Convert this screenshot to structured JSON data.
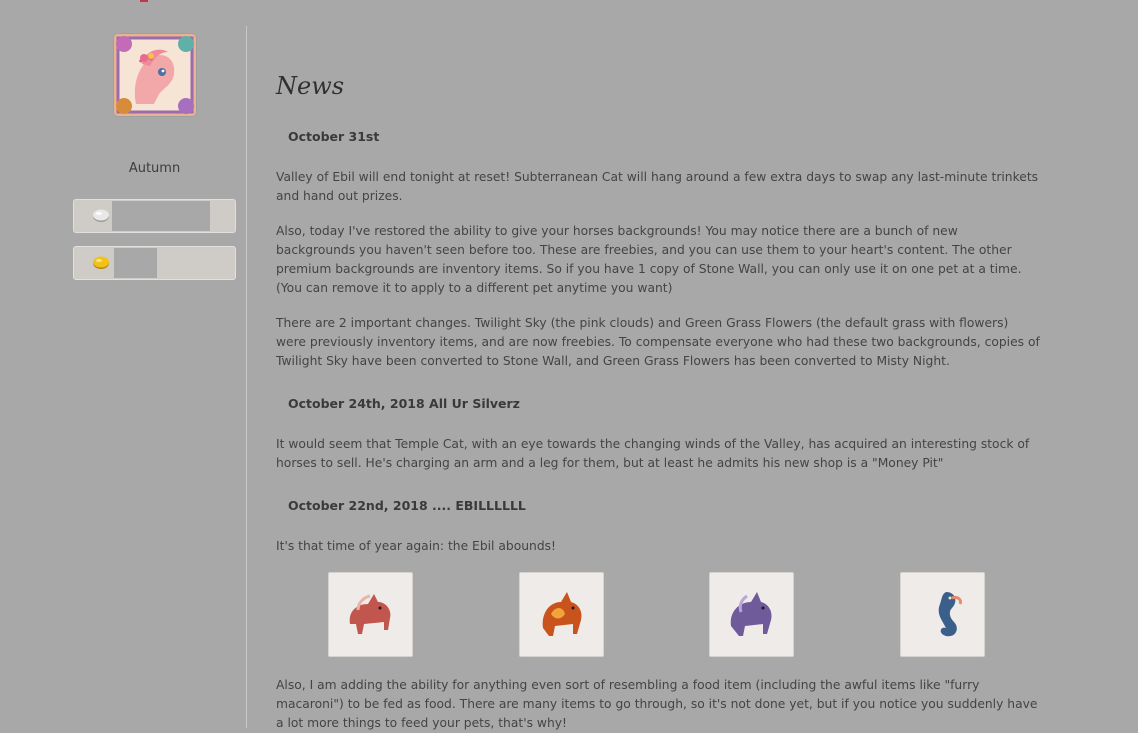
{
  "sidebar": {
    "username": "Autumn",
    "currencies": [
      {
        "name": "silver",
        "level": 0.61
      },
      {
        "name": "gold",
        "level": 0.27
      }
    ]
  },
  "news": {
    "title": "News",
    "sections": [
      {
        "heading": "October 31st",
        "paragraphs": [
          "Valley of Ebil will end tonight at reset! Subterranean Cat will hang around a few extra days to swap any last-minute trinkets and hand out prizes.",
          "Also, today I've restored the ability to give your horses backgrounds! You may notice there are a bunch of new backgrounds you haven't seen before too. These are freebies, and you can use them to your heart's content. The other premium backgrounds are inventory items. So if you have 1 copy of Stone Wall, you can only use it on one pet at a time. (You can remove it to apply to a different pet anytime you want)",
          "There are 2 important changes. Twilight Sky (the pink clouds) and Green Grass Flowers (the default grass with flowers) were previously inventory items, and are now freebies. To compensate everyone who had these two backgrounds, copies of Twilight Sky have been converted to Stone Wall, and Green Grass Flowers has been converted to Misty Night."
        ]
      },
      {
        "heading": "October 24th, 2018 All Ur Silverz",
        "paragraphs": [
          "It would seem that Temple Cat, with an eye towards the changing winds of the Valley, has acquired an interesting stock of horses to sell. He's charging an arm and a leg for them, but at least he admits his new shop is a \"Money Pit\""
        ]
      },
      {
        "heading": "October 22nd, 2018 .... EBILLLLLL",
        "paragraphs": [
          "It's that time of year again: the Ebil abounds!",
          "Also, I am adding the ability for anything even sort of resembling a food item (including the awful items like \"furry macaroni\") to be fed as food. There are many items to go through, so it's not done yet, but if you notice you suddenly have a lot more things to feed your pets, that's why!"
        ]
      }
    ],
    "horse_images": [
      {
        "icon": "red-horse-icon",
        "color": "#c0564e"
      },
      {
        "icon": "fire-horse-icon",
        "color": "#c9531c"
      },
      {
        "icon": "purple-horse-icon",
        "color": "#6f5a9a"
      },
      {
        "icon": "seahorse-icon",
        "color": "#3a5f8a"
      }
    ]
  }
}
